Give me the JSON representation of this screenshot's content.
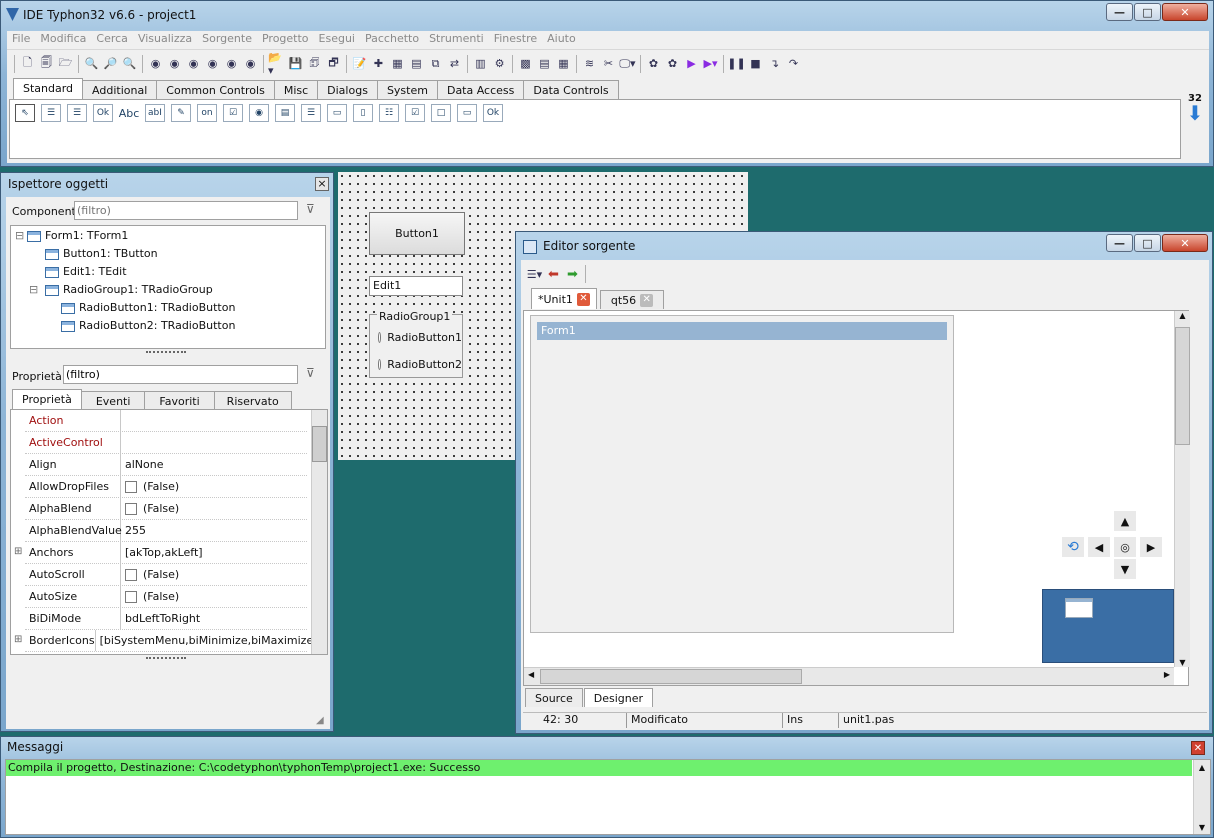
{
  "main": {
    "title": "IDE Typhon32 v6.6 - project1"
  },
  "menu": [
    "File",
    "Modifica",
    "Cerca",
    "Visualizza",
    "Sorgente",
    "Progetto",
    "Esegui",
    "Pacchetto",
    "Strumenti",
    "Finestre",
    "Aiuto"
  ],
  "palette": {
    "tabs": [
      "Standard",
      "Additional",
      "Common Controls",
      "Misc",
      "Dialogs",
      "System",
      "Data Access",
      "Data Controls"
    ],
    "ok_label": "Ok",
    "abc_label": "Abc",
    "abi_label": "abI",
    "on_label": "on",
    "ok2_label": "Ok",
    "side_number": "32"
  },
  "inspector": {
    "title": "Ispettore oggetti",
    "components_label": "Componenti",
    "components_filter_placeholder": "(filtro)",
    "close_glyph": "×",
    "tree": [
      "Form1: TForm1",
      "Button1: TButton",
      "Edit1: TEdit",
      "RadioGroup1: TRadioGroup",
      "RadioButton1: TRadioButton",
      "RadioButton2: TRadioButton"
    ],
    "props_label": "Proprietà",
    "props_filter_value": "(filtro)",
    "tabs": [
      "Proprietà",
      "Eventi",
      "Favoriti",
      "Riservato"
    ],
    "rows": [
      {
        "name": "Action",
        "value": ""
      },
      {
        "name": "ActiveControl",
        "value": ""
      },
      {
        "name": "Align",
        "value": "alNone"
      },
      {
        "name": "AllowDropFiles",
        "value": "(False)"
      },
      {
        "name": "AlphaBlend",
        "value": "(False)"
      },
      {
        "name": "AlphaBlendValue",
        "value": "255"
      },
      {
        "name": "Anchors",
        "value": "[akTop,akLeft]"
      },
      {
        "name": "AutoScroll",
        "value": "(False)"
      },
      {
        "name": "AutoSize",
        "value": "(False)"
      },
      {
        "name": "BiDiMode",
        "value": "bdLeftToRight"
      },
      {
        "name": "BorderIcons",
        "value": "[biSystemMenu,biMinimize,biMaximize]"
      }
    ]
  },
  "designer": {
    "button": "Button1",
    "edit": "Edit1",
    "group": "RadioGroup1",
    "radio1": "RadioButton1",
    "radio2": "RadioButton2"
  },
  "editor": {
    "title": "Editor sorgente",
    "tabs": [
      "*Unit1",
      "qt56"
    ],
    "form_caption": "Form1",
    "bottom_tabs": [
      "Source",
      "Designer"
    ],
    "status": {
      "position": "42: 30",
      "state": "Modificato",
      "mode": "Ins",
      "file": "unit1.pas"
    }
  },
  "messages": {
    "title": "Messaggi",
    "line": "Compila il progetto, Destinazione: C:\\codetyphon\\typhonTemp\\project1.exe: Successo"
  },
  "colors": {
    "accent_success": "#6ef06e",
    "form_caption": "#96b4d2",
    "error_red": "#c0392b"
  }
}
